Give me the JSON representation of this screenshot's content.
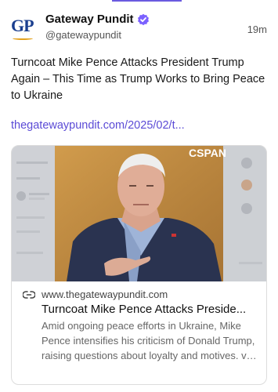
{
  "author": {
    "avatar_text": "GP",
    "name": "Gateway Pundit",
    "verified_icon": "verified-badge-icon",
    "handle": "@gatewaypundit",
    "timestamp": "19m"
  },
  "post": {
    "text": "Turncoat Mike Pence Attacks President Trump Again – This Time as Trump Works to Bring Peace to Ukraine",
    "link": "thegatewaypundit.com/2025/02/t..."
  },
  "card": {
    "image_overlay_text": "CSPAN",
    "domain_icon": "link-icon",
    "domain": "www.thegatewaypundit.com",
    "title": "Turncoat Mike Pence Attacks Preside...",
    "description": "Amid ongoing peace efforts in Ukraine, Mike Pence intensifies his criticism of Donald Trump, raising questions about loyalty and motives. ve into the latest developments in t..."
  },
  "colors": {
    "accent": "#6a5ae0",
    "link": "#5b4bd6",
    "brand_blue": "#1b3f8f",
    "brand_gold": "#e3a11d",
    "verified": "#7b61ff"
  }
}
